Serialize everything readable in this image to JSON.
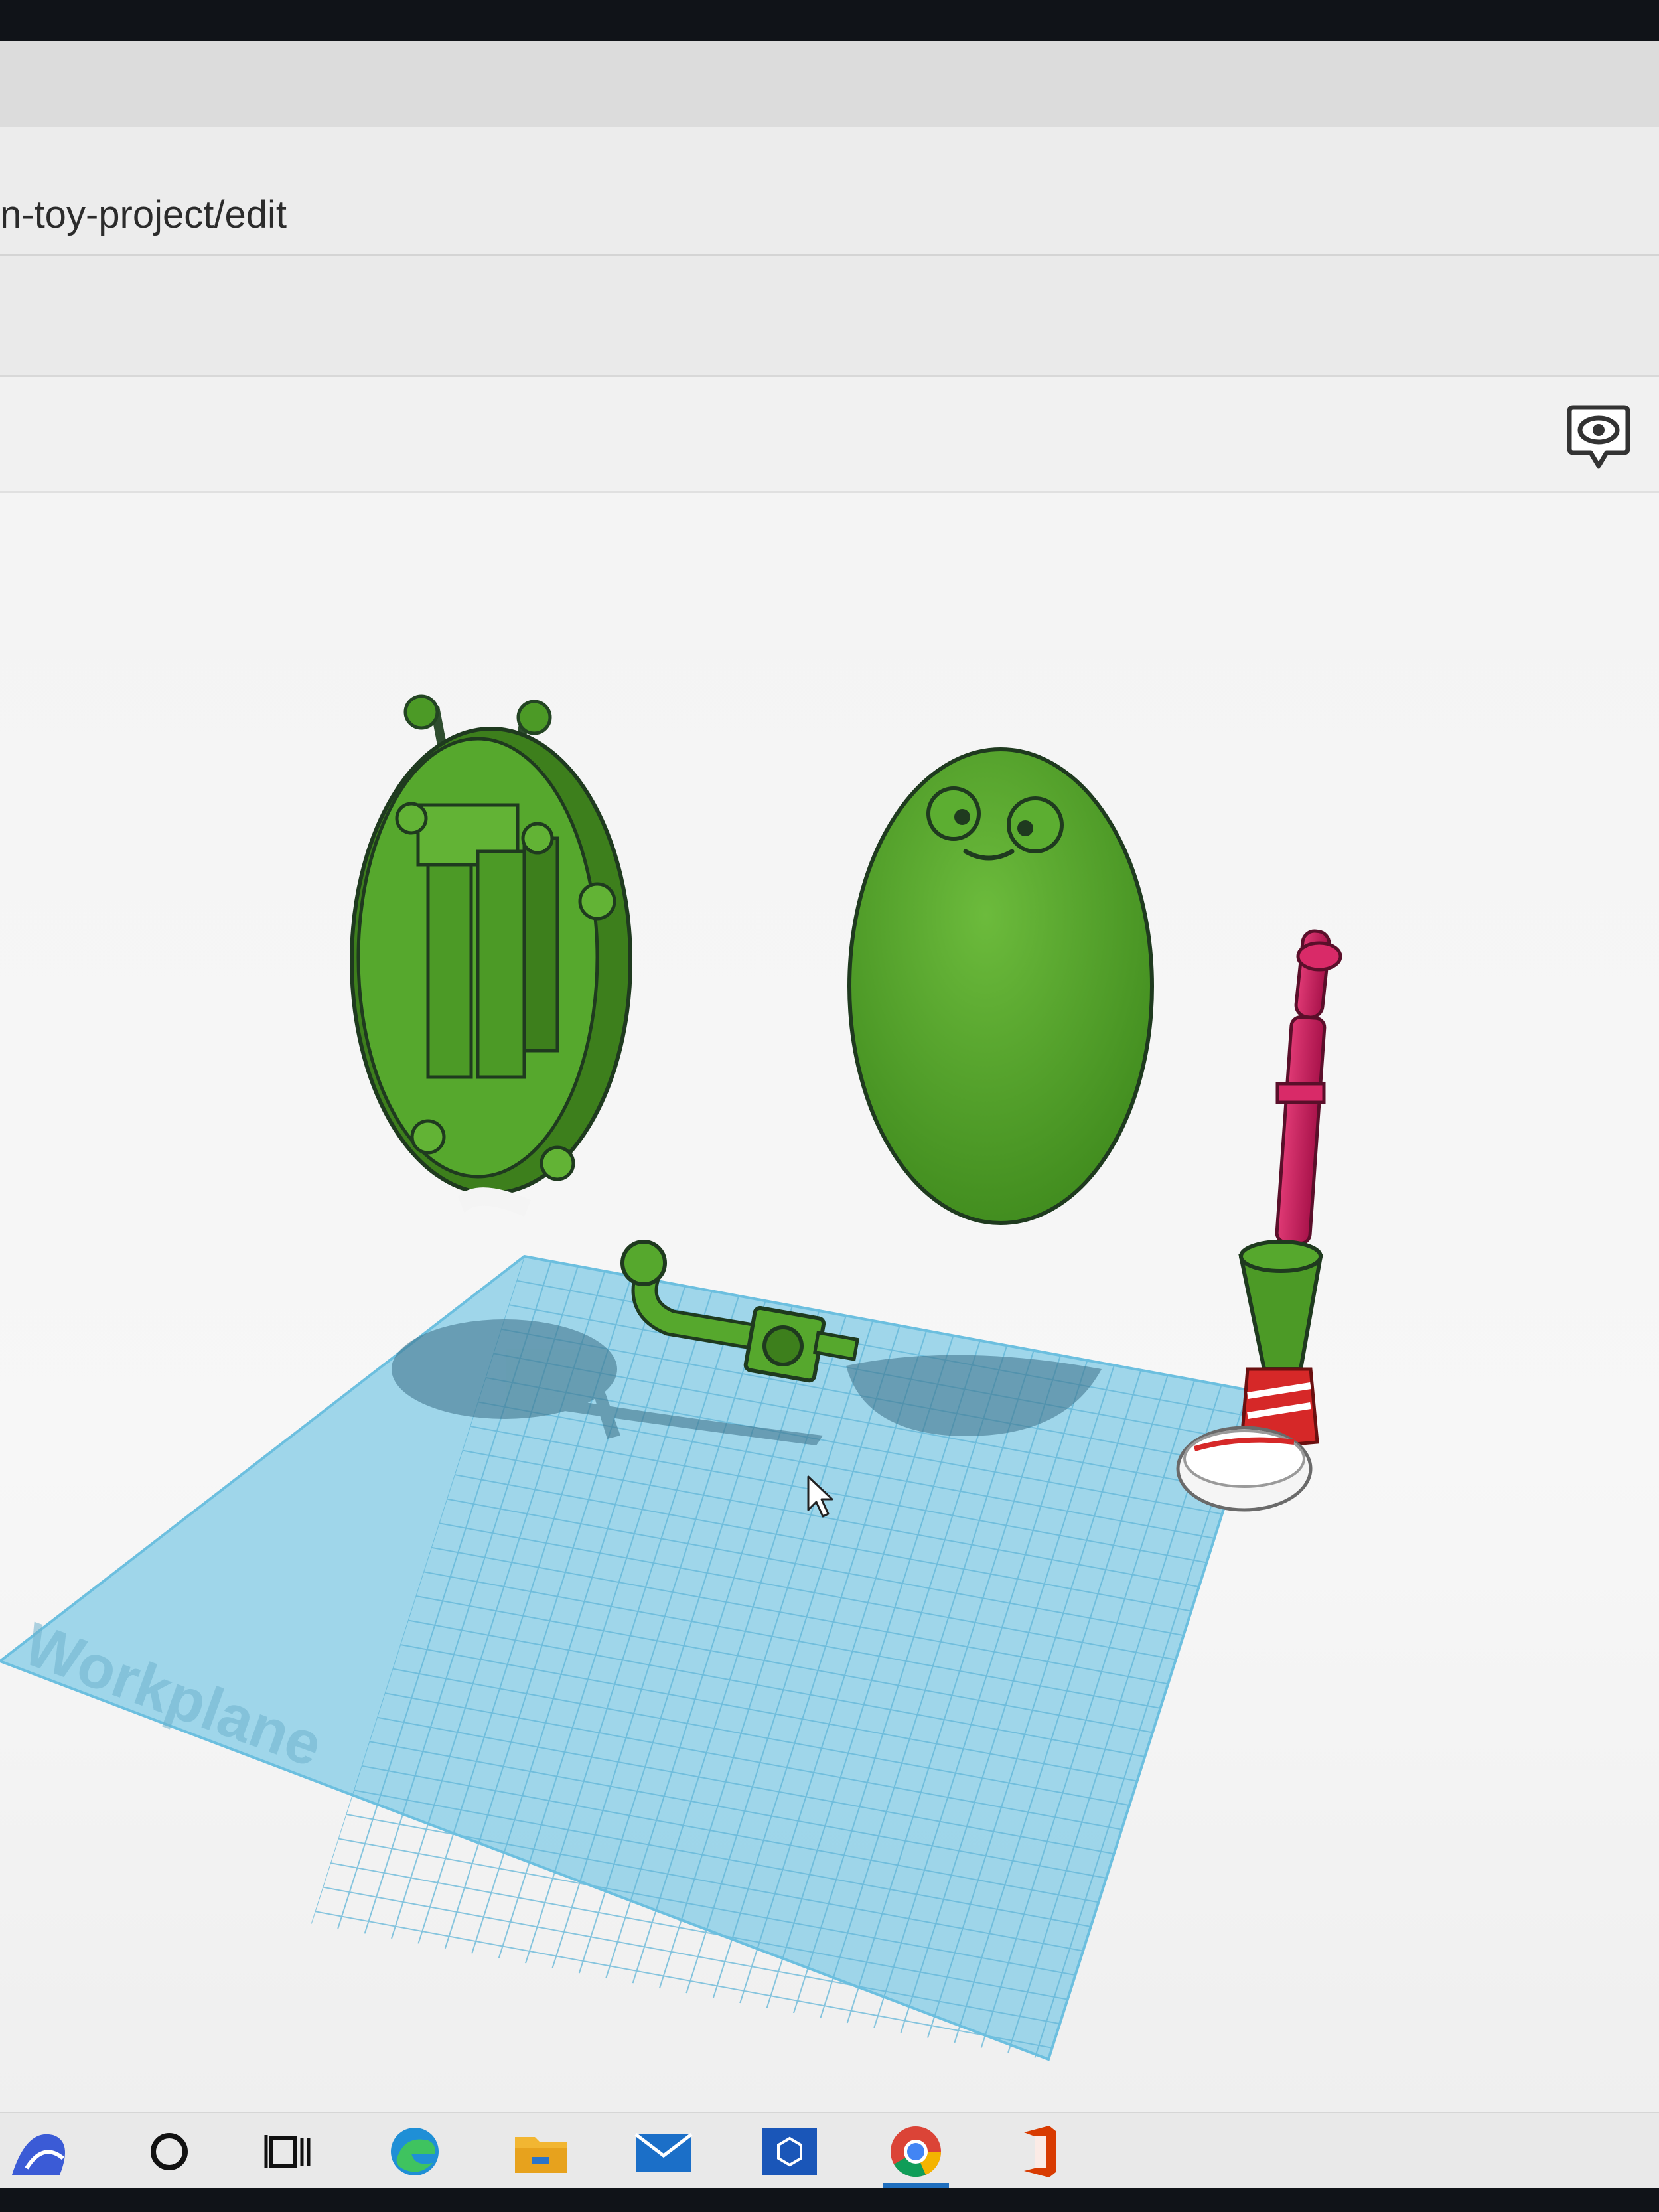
{
  "browser": {
    "url_text": "n-toy-project/edit"
  },
  "toolbar": {
    "view_icon": "eye-speech-bubble-icon"
  },
  "workplane": {
    "label": "Workplane",
    "color": "#8fd0e8",
    "grid_color": "#5fb4d6"
  },
  "objects": [
    {
      "name": "body-back-shell",
      "color": "#4c9a26"
    },
    {
      "name": "body-front-face",
      "color": "#4c9a26"
    },
    {
      "name": "arm-part",
      "color": "#4c9a26"
    },
    {
      "name": "leg-with-shoe",
      "color": "#c2185b"
    }
  ],
  "taskbar": {
    "icons": [
      "start-app-icon",
      "cortana-search-icon",
      "task-view-icon",
      "edge-icon",
      "file-explorer-icon",
      "mail-icon",
      "store-app-icon",
      "chrome-icon",
      "office-icon"
    ],
    "active": "chrome-icon"
  }
}
